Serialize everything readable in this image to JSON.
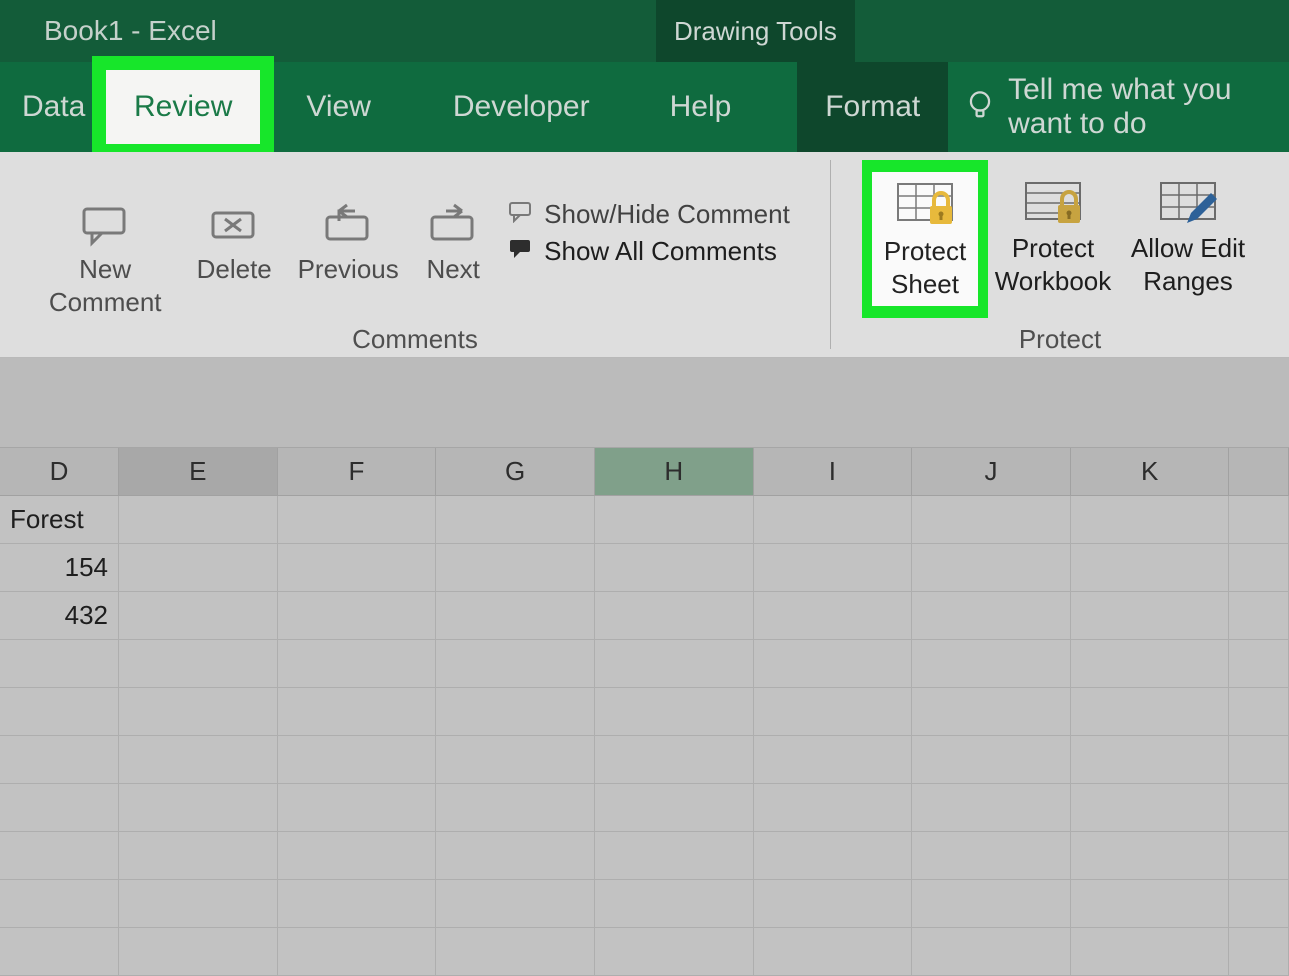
{
  "titlebar": {
    "title": "Book1  -  Excel",
    "contextual_tab": "Drawing Tools"
  },
  "tabs": {
    "data": "Data",
    "review": "Review",
    "view": "View",
    "developer": "Developer",
    "help": "Help",
    "format": "Format"
  },
  "tellme": {
    "placeholder": "Tell me what you want to do"
  },
  "ribbon": {
    "comments": {
      "group_label": "Comments",
      "new_comment": "New Comment",
      "delete": "Delete",
      "previous": "Previous",
      "next": "Next",
      "show_hide": "Show/Hide Comment",
      "show_all": "Show All Comments"
    },
    "protect": {
      "group_label": "Protect",
      "protect_sheet": "Protect Sheet",
      "protect_workbook": "Protect Workbook",
      "allow_edit_ranges": "Allow Edit Ranges"
    }
  },
  "grid": {
    "columns": [
      "D",
      "E",
      "F",
      "G",
      "H",
      "I",
      "J",
      "K"
    ],
    "selected_column": "E",
    "highlighted_column": "H",
    "rows": [
      {
        "D": "Forest",
        "align": "left"
      },
      {
        "D": "154",
        "align": "right"
      },
      {
        "D": "432",
        "align": "right"
      },
      {
        "D": ""
      },
      {
        "D": ""
      },
      {
        "D": ""
      },
      {
        "D": ""
      },
      {
        "D": ""
      },
      {
        "D": ""
      },
      {
        "D": ""
      }
    ]
  }
}
